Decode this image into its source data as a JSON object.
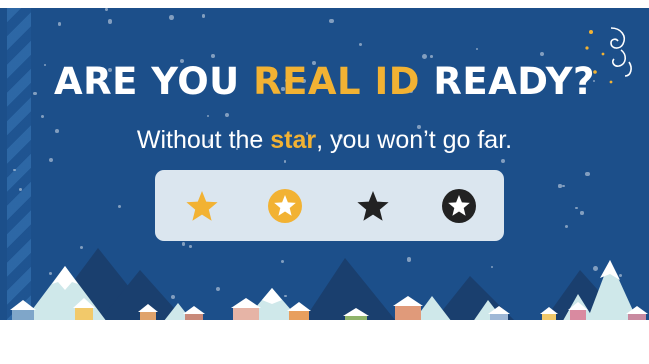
{
  "headline": {
    "part1": "ARE YOU ",
    "part2": "REAL ID",
    "part3": " READY?"
  },
  "subline": {
    "part1": "Without the ",
    "part2": "star",
    "part3": ", you won’t go far."
  },
  "star_panel": {
    "items": [
      {
        "icon": "gold-star-icon"
      },
      {
        "icon": "gold-circle-star-outline-icon"
      },
      {
        "icon": "black-star-icon"
      },
      {
        "icon": "black-circle-star-outline-icon"
      }
    ]
  },
  "colors": {
    "background": "#1c4f8a",
    "accent": "#f2b233",
    "panel": "#dbe6ef",
    "star_dark": "#222222"
  }
}
